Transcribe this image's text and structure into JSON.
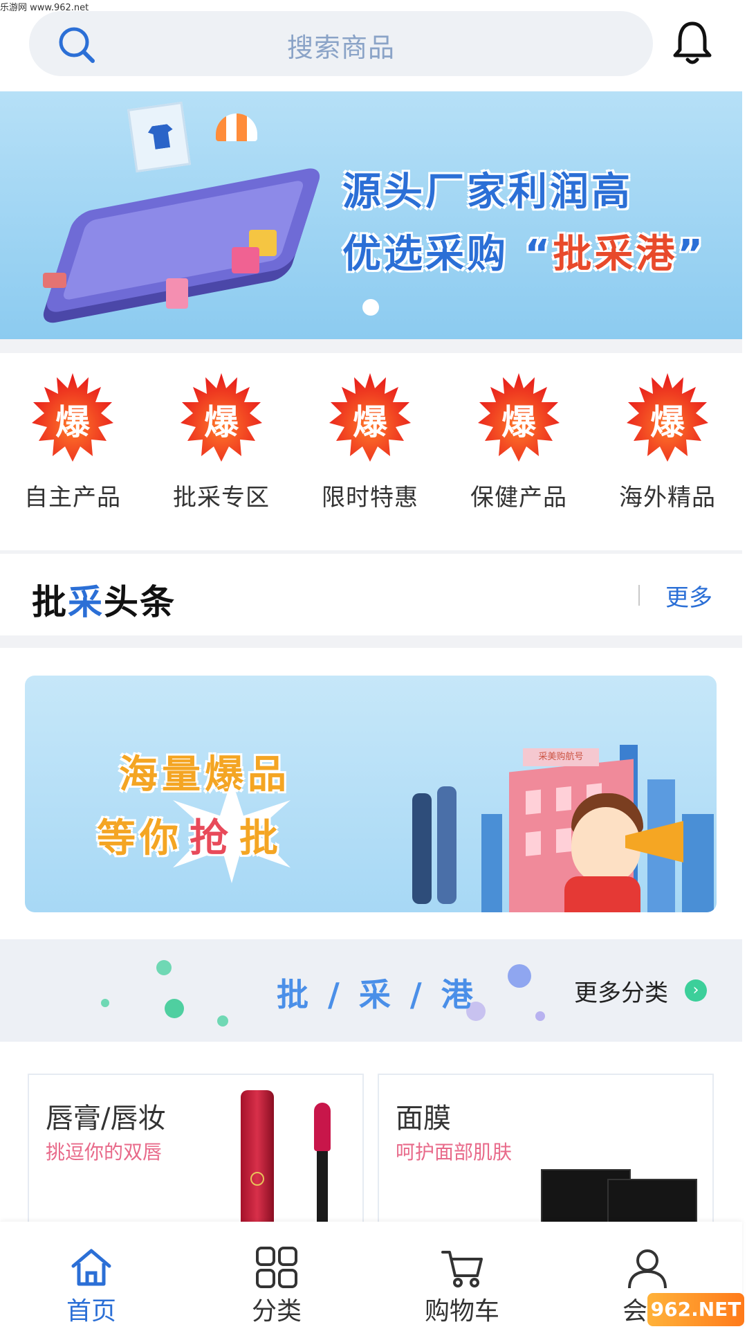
{
  "watermark": {
    "top_text": "乐游网 www.962.net",
    "logo_text": "962.NET"
  },
  "search": {
    "placeholder": "搜索商品"
  },
  "banner1": {
    "line1": "源头厂家利润高",
    "line2_prefix": "优选采购 “",
    "line2_highlight": "批采港",
    "line2_suffix": "”"
  },
  "categories": [
    {
      "badge": "爆",
      "label": "自主产品"
    },
    {
      "badge": "爆",
      "label": "批采专区"
    },
    {
      "badge": "爆",
      "label": "限时特惠"
    },
    {
      "badge": "爆",
      "label": "保健产品"
    },
    {
      "badge": "爆",
      "label": "海外精品"
    }
  ],
  "headline": {
    "title_a": "批",
    "title_b": "采",
    "title_c": "头条",
    "more": "更多"
  },
  "banner2": {
    "line1": "海量爆品",
    "line2a": "等你",
    "line2b": "抢",
    "line2c": "批",
    "sign": "采美购航号"
  },
  "pcg": {
    "title": "批 / 采 / 港",
    "more": "更多分类",
    "arrow": "›"
  },
  "products": [
    {
      "title": "唇膏/唇妆",
      "subtitle": "挑逗你的双唇"
    },
    {
      "title": "面膜",
      "subtitle": "呵护面部肌肤"
    }
  ],
  "nav": [
    {
      "label": "首页",
      "icon": "home-icon",
      "active": true
    },
    {
      "label": "分类",
      "icon": "grid-icon",
      "active": false
    },
    {
      "label": "购物车",
      "icon": "cart-icon",
      "active": false
    },
    {
      "label": "会员",
      "icon": "user-icon",
      "active": false
    }
  ],
  "colors": {
    "primary": "#2b6fd6",
    "accent_red": "#e84a2b",
    "bg_gray": "#f1f2f5"
  }
}
